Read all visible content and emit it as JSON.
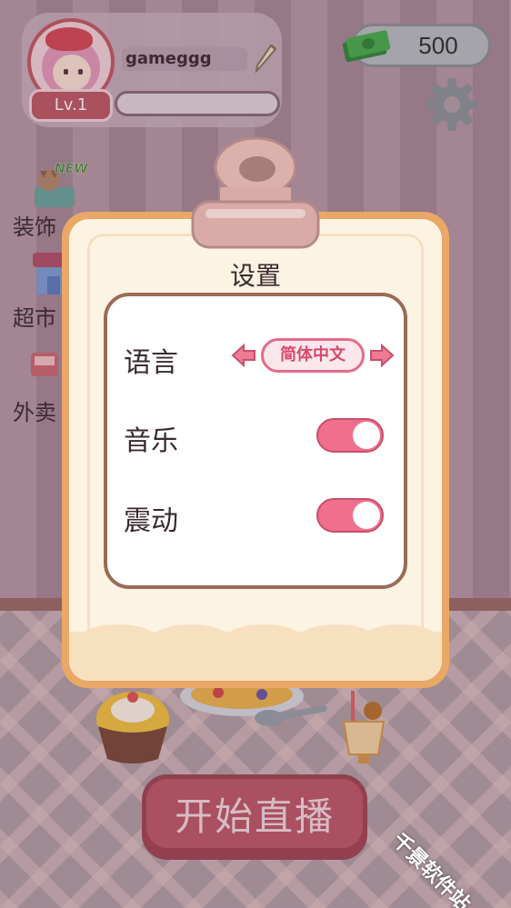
{
  "hud": {
    "username": "gameggg",
    "level": "Lv.1",
    "coins": "500"
  },
  "side_menu": [
    {
      "label": "装饰",
      "badge": "NEW"
    },
    {
      "label": "超市"
    },
    {
      "label": "外卖"
    }
  ],
  "settings": {
    "title": "设置",
    "language": {
      "label": "语言",
      "value": "简体中文"
    },
    "music": {
      "label": "音乐",
      "enabled": true
    },
    "vibration": {
      "label": "震动",
      "enabled": true
    }
  },
  "start_button": "开始直播",
  "watermark": "千景软件站",
  "colors": {
    "accent_pink": "#ef6f8c",
    "modal_border": "#e9a865",
    "start_button": "#c05a69"
  }
}
